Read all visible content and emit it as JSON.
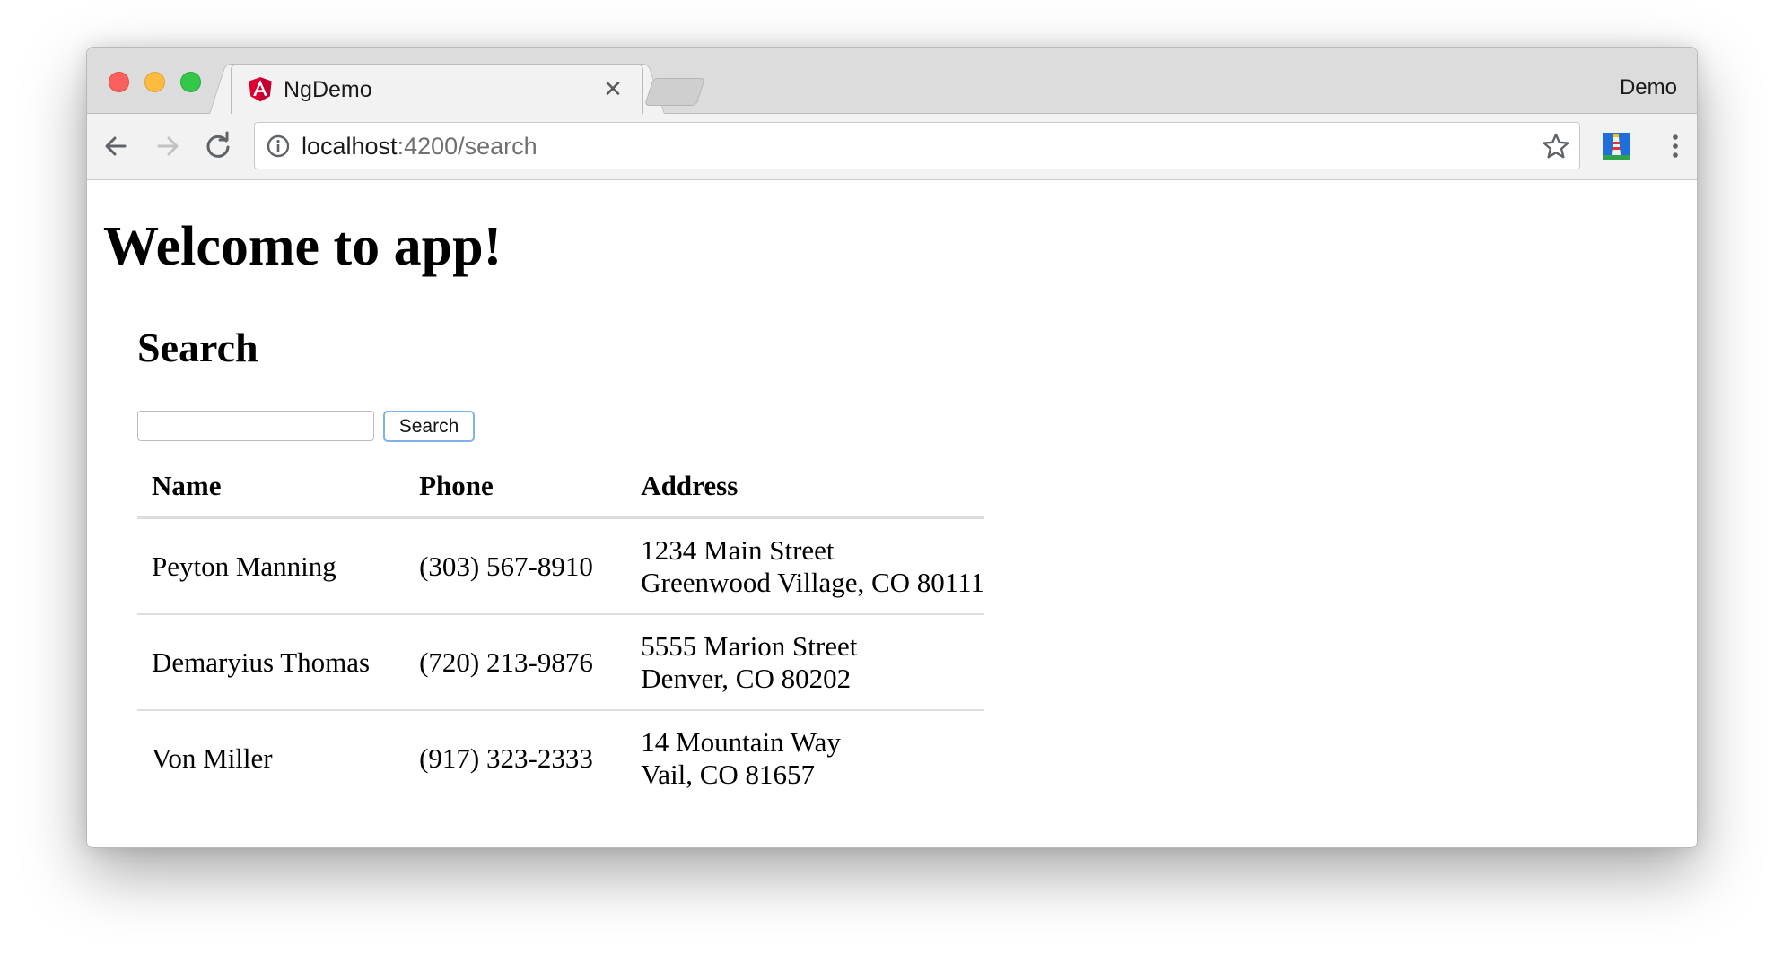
{
  "browser": {
    "tab": {
      "title": "NgDemo",
      "favicon": "angular-logo-icon",
      "close_icon": "close-icon"
    },
    "profile_name": "Demo",
    "nav": {
      "back_icon": "arrow-left-icon",
      "forward_icon": "arrow-right-icon",
      "reload_icon": "reload-icon"
    },
    "address_bar": {
      "info_icon": "info-icon",
      "url_host": "localhost",
      "url_rest": ":4200/search",
      "bookmark_icon": "star-icon"
    },
    "extension_icon": "lighthouse-extension-icon",
    "menu_icon": "vertical-dots-menu-icon"
  },
  "colors": {
    "close_light": "#fc605c",
    "minimize_light": "#fdbc40",
    "maximize_light": "#34c84a",
    "angular_red": "#dd0031",
    "button_focus_border": "#7fb1ec"
  },
  "page": {
    "heading": "Welcome to app!",
    "search_heading": "Search",
    "search_input": {
      "value": "",
      "placeholder": ""
    },
    "search_button": "Search",
    "table": {
      "headers": [
        "Name",
        "Phone",
        "Address"
      ],
      "rows": [
        {
          "name": "Peyton Manning",
          "phone": "(303) 567-8910",
          "address_line1": "1234 Main Street",
          "address_line2": "Greenwood Village, CO 80111"
        },
        {
          "name": "Demaryius Thomas",
          "phone": "(720) 213-9876",
          "address_line1": "5555 Marion Street",
          "address_line2": "Denver, CO 80202"
        },
        {
          "name": "Von Miller",
          "phone": "(917) 323-2333",
          "address_line1": "14 Mountain Way",
          "address_line2": "Vail, CO 81657"
        }
      ]
    }
  }
}
